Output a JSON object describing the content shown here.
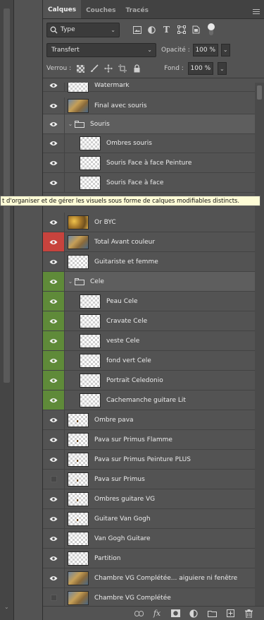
{
  "tabs": [
    {
      "label": "Calques",
      "active": true
    },
    {
      "label": "Couches",
      "active": false
    },
    {
      "label": "Tracés",
      "active": false
    }
  ],
  "filter": {
    "kind": "Type"
  },
  "blend": {
    "mode": "Transfert",
    "opacity_label": "Opacité :",
    "opacity_value": "100 %"
  },
  "lock": {
    "label": "Verrou :",
    "fill_label": "Fond :",
    "fill_value": "100 %"
  },
  "tooltip": "t d'organiser et de gérer les visuels sous forme de calques modifiables distincts.",
  "layers": [
    {
      "name": "Watermark",
      "eye": "on",
      "thumb": "check",
      "indent": 0
    },
    {
      "name": "Final avec souris",
      "eye": "on",
      "thumb": "photo",
      "indent": 0
    },
    {
      "name": "Souris",
      "eye": "on",
      "type": "group",
      "expanded": true,
      "indent": 0
    },
    {
      "name": "Ombres souris",
      "eye": "on",
      "thumb": "check",
      "indent": 1
    },
    {
      "name": "Souris Face à face Peinture",
      "eye": "on",
      "thumb": "check",
      "indent": 1
    },
    {
      "name": "Souris Face à face",
      "eye": "on",
      "thumb": "check",
      "indent": 1
    },
    {
      "name": "Or BYC",
      "eye": "on",
      "thumb": "gold",
      "indent": 0
    },
    {
      "name": "Total Avant couleur",
      "eye": "red",
      "thumb": "photo",
      "indent": 0
    },
    {
      "name": "Guitariste et femme",
      "eye": "on",
      "thumb": "check",
      "indent": 0
    },
    {
      "name": "Cele",
      "eye": "green",
      "type": "group",
      "expanded": true,
      "indent": 0
    },
    {
      "name": "Peau Cele",
      "eye": "green",
      "thumb": "check",
      "indent": 1
    },
    {
      "name": "Cravate Cele",
      "eye": "green",
      "thumb": "check",
      "indent": 1
    },
    {
      "name": "veste Cele",
      "eye": "green",
      "thumb": "check",
      "indent": 1
    },
    {
      "name": "fond vert Cele",
      "eye": "green",
      "thumb": "check",
      "indent": 1
    },
    {
      "name": "Portrait Celedonio",
      "eye": "green",
      "thumb": "check",
      "indent": 1
    },
    {
      "name": "Cachemanche guitare Lit",
      "eye": "green",
      "thumb": "check",
      "indent": 1
    },
    {
      "name": "Ombre pava",
      "eye": "on",
      "thumb": "check",
      "indent": 0
    },
    {
      "name": "Pava sur Primus Flamme",
      "eye": "on",
      "thumb": "check",
      "indent": 0
    },
    {
      "name": "Pava sur Primus Peinture PLUS",
      "eye": "on",
      "thumb": "check",
      "indent": 0
    },
    {
      "name": "Pava sur Primus",
      "eye": "off",
      "thumb": "check",
      "indent": 0
    },
    {
      "name": "Ombres guitare VG",
      "eye": "on",
      "thumb": "check",
      "indent": 0
    },
    {
      "name": "Guitare Van Gogh",
      "eye": "on",
      "thumb": "check",
      "indent": 0
    },
    {
      "name": "Van Gogh Guitare",
      "eye": "on",
      "thumb": "check",
      "indent": 0
    },
    {
      "name": "Partition",
      "eye": "on",
      "thumb": "check",
      "indent": 0
    },
    {
      "name": "Chambre VG Complétée... aiguiere ni fenêtre",
      "eye": "on",
      "thumb": "photo",
      "indent": 0
    },
    {
      "name": "Chambre VG Complétée",
      "eye": "off",
      "thumb": "photo",
      "indent": 0
    }
  ],
  "bottom_icons": [
    "link-icon",
    "fx-icon",
    "mask-icon",
    "adjustment-icon",
    "new-group-icon",
    "new-layer-icon",
    "trash-icon"
  ]
}
